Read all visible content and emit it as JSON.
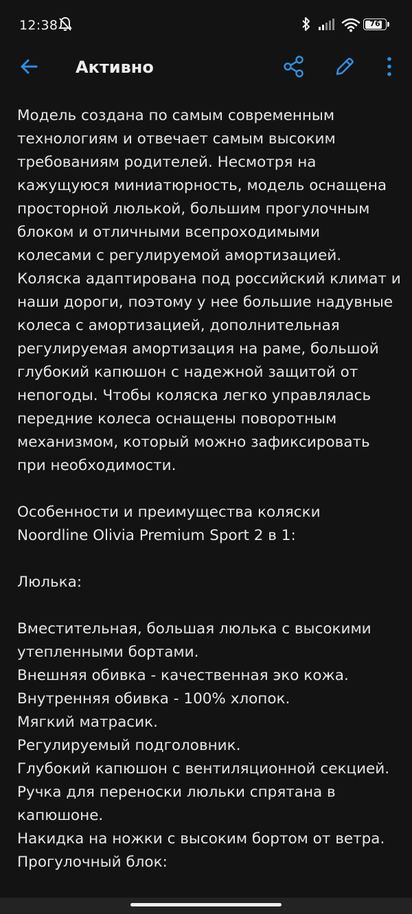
{
  "status_bar": {
    "time": "12:38",
    "battery_level": "76",
    "icons": [
      "dnd-off-icon",
      "bluetooth-icon",
      "signal-icon",
      "wifi-icon",
      "battery-icon"
    ]
  },
  "app_bar": {
    "title": "Активно",
    "icons": {
      "back": "arrow-left-icon",
      "share": "share-icon",
      "edit": "pencil-icon",
      "more": "more-vertical-icon"
    },
    "accent_color": "#2f8fe0"
  },
  "content": {
    "lines": [
      "Модель создана по самым современным",
      "технологиям и отвечает самым высоким",
      "требованиям родителей. Несмотря на",
      "кажущуюся миниатюрность, модель оснащена",
      "просторной люлькой, большим прогулочным",
      "блоком и отличными всепроходимыми",
      "колесами с регулируемой амортизацией.",
      "Коляска адаптирована под российский климат и",
      "наши дороги, поэтому у нее большие надувные",
      "колеса с амортизацией, дополнительная",
      "регулируемая амортизация на раме, большой",
      "глубокий капюшон с надежной защитой от",
      "непогоды. Чтобы коляска легко управлялась",
      "передние колеса оснащены поворотным",
      "механизмом, который можно зафиксировать",
      "при необходимости.",
      "",
      "Особенности и преимущества коляски",
      "Noordline Olivia Premium Sport 2 в 1:",
      "",
      "Люлька:",
      "",
      "Вместительная, большая люлька с высокими",
      "утепленными бортами.",
      "Внешняя обивка - качественная эко кожа.",
      "Внутренняя обивка - 100% хлопок.",
      "Мягкий матрасик.",
      "Регулируемый подголовник.",
      "Глубокий капюшон с вентиляционной секцией.",
      "Ручка для переноски люльки спрятана в",
      "капюшоне.",
      "Накидка на ножки с высоким бортом от ветра.",
      "Прогулочный блок:"
    ]
  }
}
